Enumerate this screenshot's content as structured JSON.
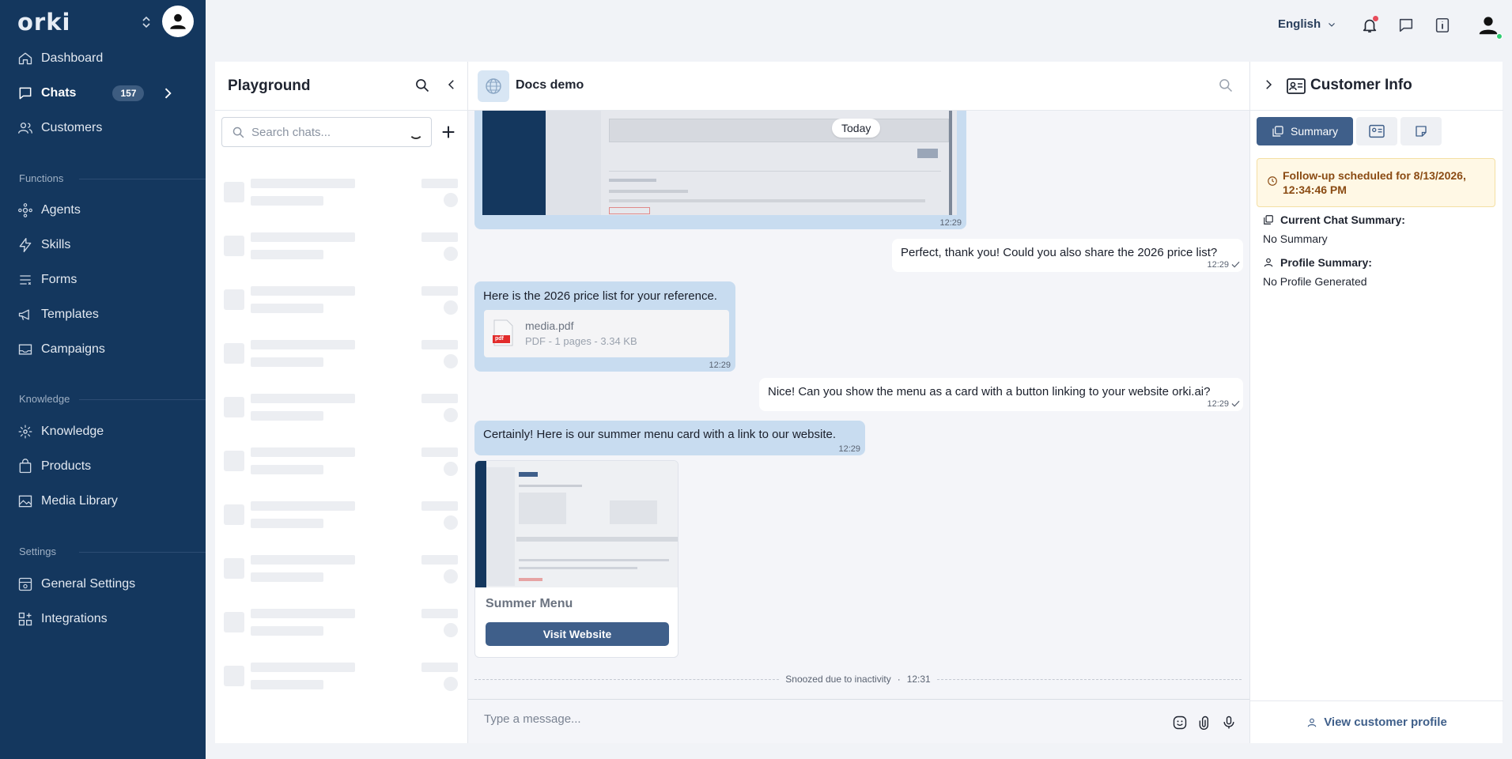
{
  "brand": {
    "name": "orki"
  },
  "colors": {
    "sidebar": "#14375e",
    "accent": "#3f5f8a",
    "incoming_bubble": "#c8dcf0",
    "followup_bg": "#fff8e5",
    "followup_text": "#8a4b13"
  },
  "sidebar": {
    "items": [
      {
        "label": "Dashboard",
        "icon": "home-icon"
      },
      {
        "label": "Chats",
        "icon": "chat-icon",
        "badge": "157"
      },
      {
        "label": "Customers",
        "icon": "users-icon"
      }
    ],
    "sections": [
      {
        "label": "Functions",
        "items": [
          {
            "label": "Agents",
            "icon": "agents-icon"
          },
          {
            "label": "Skills",
            "icon": "bolt-icon"
          },
          {
            "label": "Forms",
            "icon": "forms-icon"
          },
          {
            "label": "Templates",
            "icon": "megaphone-icon"
          },
          {
            "label": "Campaigns",
            "icon": "mail-icon"
          }
        ]
      },
      {
        "label": "Knowledge",
        "items": [
          {
            "label": "Knowledge",
            "icon": "knowledge-icon"
          },
          {
            "label": "Products",
            "icon": "bag-icon"
          },
          {
            "label": "Media Library",
            "icon": "image-icon"
          }
        ]
      },
      {
        "label": "Settings",
        "items": [
          {
            "label": "General Settings",
            "icon": "gear-icon"
          },
          {
            "label": "Integrations",
            "icon": "grid-plus-icon"
          }
        ]
      }
    ]
  },
  "topbar": {
    "language": "English"
  },
  "chat_list": {
    "title": "Playground",
    "search_placeholder": "Search chats..."
  },
  "chat": {
    "name": "Docs demo",
    "day_label": "Today",
    "messages": [
      {
        "direction": "in",
        "type": "image",
        "time": "12:29"
      },
      {
        "direction": "out",
        "text": "Perfect, thank you! Could you also share the 2026 price list?",
        "time": "12:29"
      },
      {
        "direction": "in",
        "text": "Here is the 2026 price list for your reference.",
        "time": "12:29",
        "attachment": {
          "name": "media.pdf",
          "meta": "PDF - 1 pages - 3.34 KB",
          "badge": "pdf"
        }
      },
      {
        "direction": "out",
        "text": "Nice! Can you show the menu as a card with a button linking to your website orki.ai?",
        "time": "12:29"
      },
      {
        "direction": "in",
        "text": "Certainly! Here is our summer menu card with a link to our website.",
        "time": "12:29"
      }
    ],
    "card": {
      "title": "Summer Menu",
      "button": "Visit Website"
    },
    "status": {
      "text": "Snoozed due to inactivity",
      "separator": "·",
      "time": "12:31"
    },
    "composer_placeholder": "Type a message..."
  },
  "customer_info": {
    "title": "Customer Info",
    "tabs": [
      {
        "label": "Summary"
      }
    ],
    "followup": "Follow-up scheduled for 8/13/2026, 12:34:46 PM",
    "current_chat_summary": {
      "label": "Current Chat Summary:",
      "value": "No Summary"
    },
    "profile_summary": {
      "label": "Profile Summary:",
      "value": "No Profile Generated"
    },
    "view_profile": "View customer profile"
  }
}
